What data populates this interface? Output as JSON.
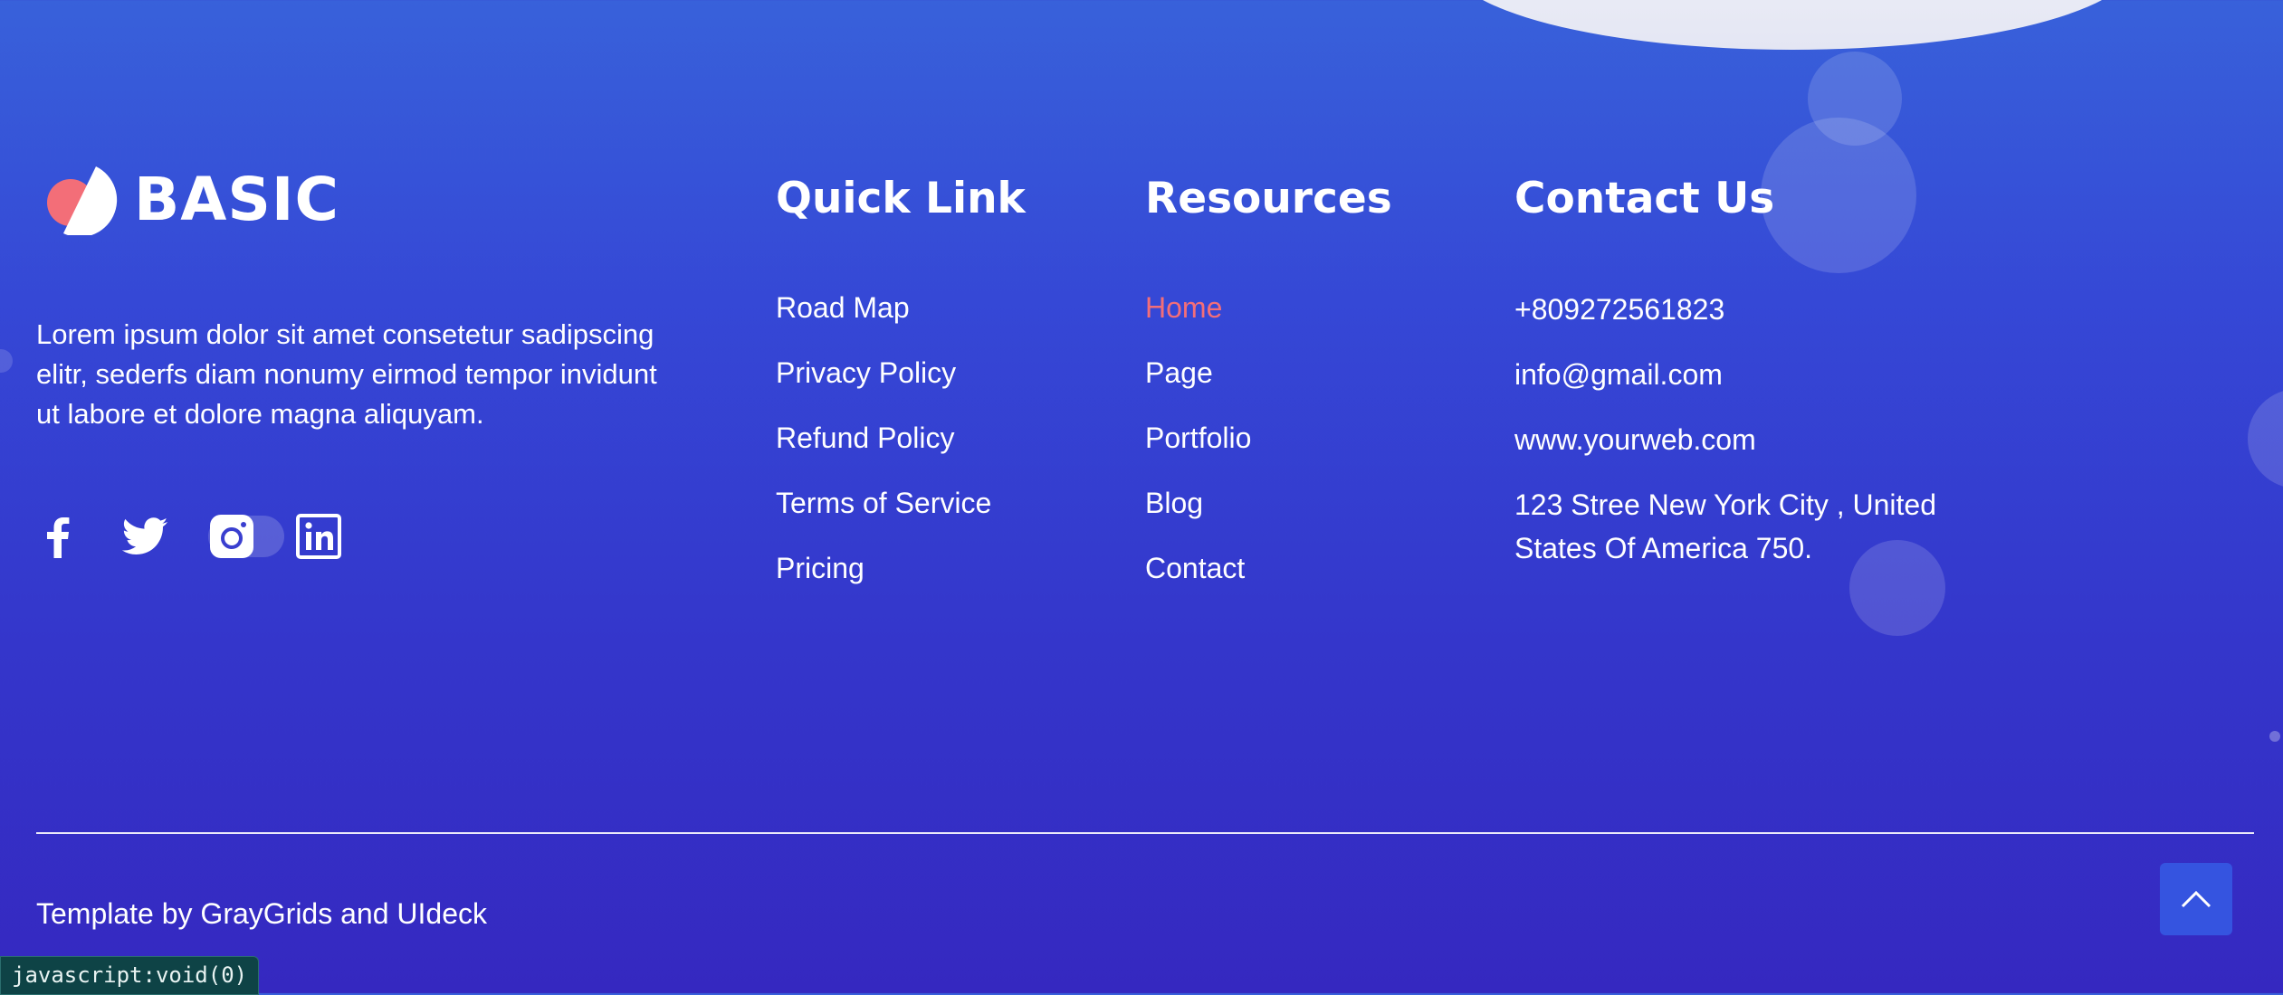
{
  "brand": {
    "name": "BASIC",
    "accent": "#f36e78"
  },
  "about": "Lorem ipsum dolor sit amet consetetur sadipscing elitr, sederfs diam nonumy eirmod tempor invidunt ut labore et dolore magna aliquyam.",
  "social": [
    {
      "icon": "facebook-icon"
    },
    {
      "icon": "twitter-icon"
    },
    {
      "icon": "instagram-icon"
    },
    {
      "icon": "linkedin-icon"
    }
  ],
  "quick_link": {
    "title": "Quick Link",
    "items": [
      "Road Map",
      "Privacy Policy",
      "Refund Policy",
      "Terms of Service",
      "Pricing"
    ]
  },
  "resources": {
    "title": "Resources",
    "items": [
      "Home",
      "Page",
      "Portfolio",
      "Blog",
      "Contact"
    ],
    "active": "Home"
  },
  "contact": {
    "title": "Contact Us",
    "phone": "+809272561823",
    "email": "info@gmail.com",
    "website": "www.yourweb.com",
    "address": "123 Stree New York City , United States Of America 750."
  },
  "credits": "Template by GrayGrids and UIdeck",
  "back_to_top": {
    "icon": "chevron-up-icon"
  },
  "status_bar": "javascript:void(0)"
}
